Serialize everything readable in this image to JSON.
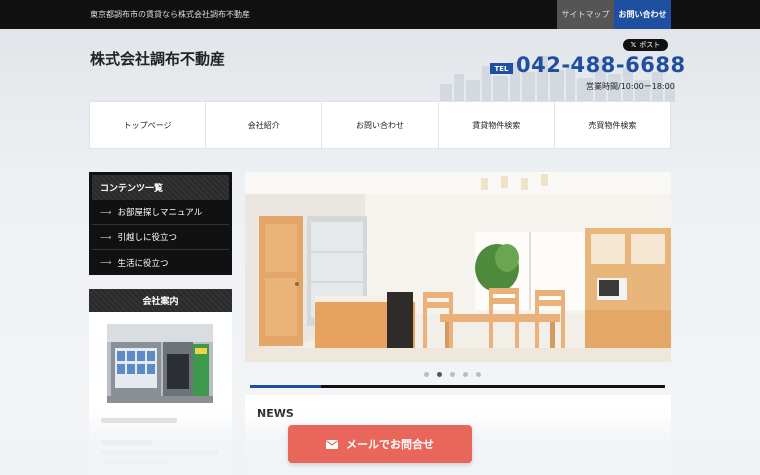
{
  "topbar": {
    "tagline": "東京都調布市の賃貸なら株式会社調布不動産",
    "sitemap_label": "サイトマップ",
    "contact_label": "お問い合わせ"
  },
  "header": {
    "company_name": "株式会社調布不動産",
    "post_label": "ポスト",
    "tel_badge": "TEL",
    "tel_number": "042-488-6688",
    "hours": "営業時間/10:00ー18:00"
  },
  "nav": {
    "items": [
      {
        "label": "トップページ"
      },
      {
        "label": "会社紹介"
      },
      {
        "label": "お問い合わせ"
      },
      {
        "label": "賃貸物件検索"
      },
      {
        "label": "売買物件検索"
      }
    ]
  },
  "sidebar": {
    "contents_title": "コンテンツ一覧",
    "items": [
      {
        "label": "お部屋探しマニュアル"
      },
      {
        "label": "引越しに役立つ"
      },
      {
        "label": "生活に役立つ"
      }
    ],
    "company_title": "会社案内"
  },
  "slider": {
    "slide_count": 5,
    "active_index": 1,
    "progress": 0.17
  },
  "news": {
    "title": "NEWS"
  },
  "cta": {
    "mail_label": "メールでお問合せ"
  },
  "colors": {
    "brand_blue": "#1f4fa0",
    "cta_red": "#e8665a",
    "dark": "#111111"
  }
}
